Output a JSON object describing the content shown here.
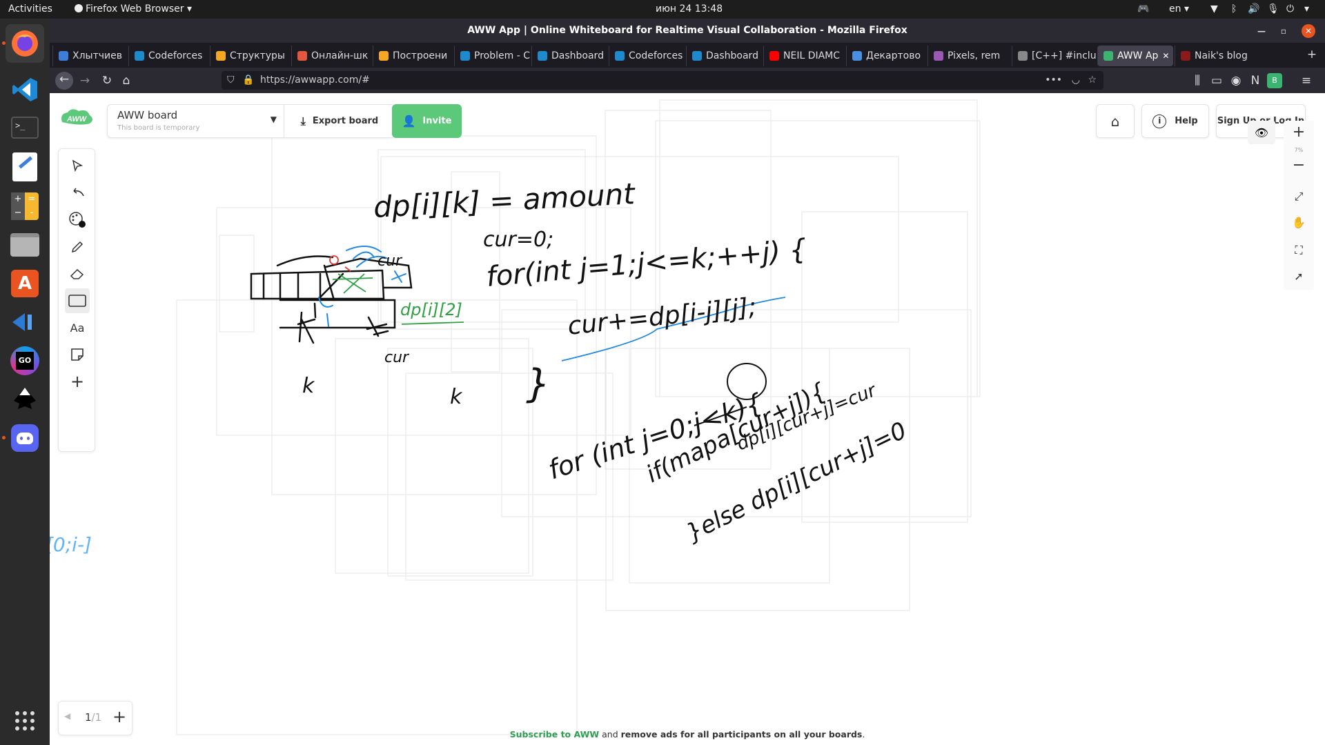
{
  "system": {
    "activities": "Activities",
    "app_menu": "Firefox Web Browser",
    "clock": "июн 24  13:48",
    "language": "en"
  },
  "window": {
    "title": "AWW App | Online Whiteboard for Realtime Visual Collaboration - Mozilla Firefox"
  },
  "tabs": [
    {
      "label": "Хлытчиев",
      "favicon_color": "#3d7edb"
    },
    {
      "label": "Codeforces",
      "favicon_color": "#1f8acb"
    },
    {
      "label": "Структуры",
      "favicon_color": "#f5a623"
    },
    {
      "label": "Онлайн-шк",
      "favicon_color": "#e2583e"
    },
    {
      "label": "Построени",
      "favicon_color": "#f5a623"
    },
    {
      "label": "Problem - C",
      "favicon_color": "#1f8acb"
    },
    {
      "label": "Dashboard",
      "favicon_color": "#1f8acb"
    },
    {
      "label": "Codeforces",
      "favicon_color": "#1f8acb"
    },
    {
      "label": "Dashboard",
      "favicon_color": "#1f8acb"
    },
    {
      "label": "NEIL DIAMC",
      "favicon_color": "#ff0000"
    },
    {
      "label": "Декартово",
      "favicon_color": "#4a90e2"
    },
    {
      "label": "Pixels, rem",
      "favicon_color": "#9b59b6"
    },
    {
      "label": "[C++] #inclu",
      "favicon_color": "#888888"
    },
    {
      "label": "AWW Ap",
      "favicon_color": "#3cb371",
      "active": true
    },
    {
      "label": "Naik's blog",
      "favicon_color": "#8b1a1a"
    }
  ],
  "url": "https://awwapp.com/#",
  "board": {
    "name": "AWW board",
    "subtitle": "This board is temporary",
    "export_label": "Export board",
    "invite_label": "Invite",
    "help_label": "Help",
    "signup_label": "Sign Up or Log In",
    "zoom_label": "7%",
    "page_current": "1",
    "page_total": "/1",
    "tools_text_label": "Aa"
  },
  "promo": {
    "link_text": "Subscribe to AWW",
    "middle_text": " and ",
    "bold_text": "remove ads for all participants on all your boards",
    "end_text": "."
  },
  "canvas_text": {
    "line1": "dp[i][k] = amount",
    "line2": "cur=0;",
    "line3": "for(int j=1;j<=k;++j) {",
    "line4": "cur+=dp[i-j][j];",
    "line5": "}",
    "line6": "for (int j=0;j<k){",
    "line7": "if(mapa[cur+j]){",
    "line8": "dp[i][cur+j]=cur",
    "line9": "}else dp[i][cur+j]=0",
    "label_cur_top": "cur",
    "label_cur_bottom": "cur",
    "label_k": "k",
    "label_k2": "k",
    "label_dp": "dp[i][2]",
    "label_range": "[0;i-]"
  },
  "colors": {
    "brand_green": "#5cc97a",
    "ink_black": "#111111",
    "ink_blue": "#1e88e5",
    "ink_green": "#2ea043",
    "ink_red": "#e53935",
    "ink_light_blue": "#64b5f6"
  }
}
